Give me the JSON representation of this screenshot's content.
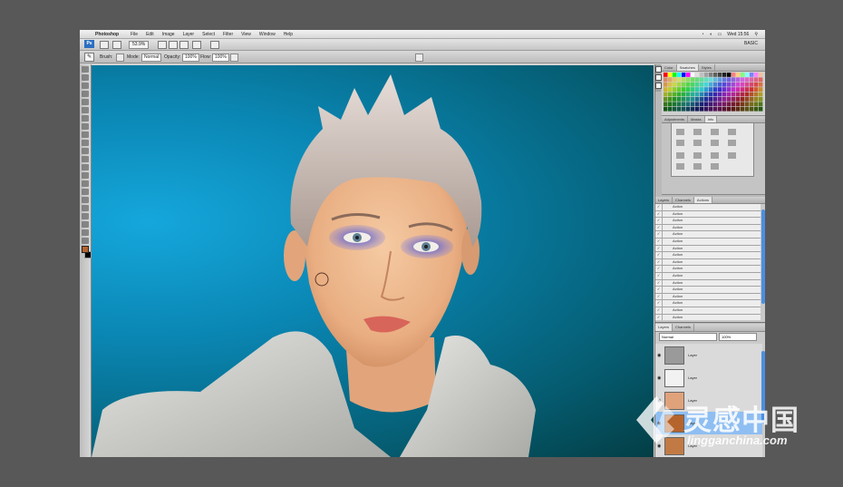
{
  "menubar": {
    "apple": "",
    "app_name": "Photoshop",
    "menus": [
      "File",
      "Edit",
      "Image",
      "Layer",
      "Select",
      "Filter",
      "View",
      "Window",
      "Help"
    ],
    "clock": "Wed 15:56"
  },
  "appbar": {
    "badge": "Ps",
    "zoom": "53.9%",
    "workspace": "BASIC"
  },
  "options": {
    "brush_label": "Brush:",
    "mode_label": "Mode:",
    "mode_value": "Normal",
    "opacity_label": "Opacity:",
    "opacity_value": "100%",
    "flow_label": "Flow:",
    "flow_value": "100%"
  },
  "swatches_panel": {
    "tabs": [
      "Color",
      "Swatches",
      "Styles"
    ],
    "active_tab": "Swatches"
  },
  "adjustments_panel": {
    "tabs": [
      "Adjustments",
      "Masks",
      "Info"
    ],
    "active_tab": "Info"
  },
  "actions_panel": {
    "tabs": [
      "Layers",
      "Channels",
      "Actions"
    ],
    "active_tab": "Actions",
    "items": [
      "Action",
      "Action",
      "Action",
      "Action",
      "Action",
      "Action",
      "Action",
      "Action",
      "Action",
      "Action",
      "Action",
      "Action",
      "Action",
      "Action",
      "Action",
      "Action",
      "Action",
      "Action",
      "Action"
    ],
    "selected_item": "Action"
  },
  "layers_panel": {
    "tabs": [
      "Layers",
      "Channels"
    ],
    "blend_mode": "Normal",
    "opacity": "100%",
    "layers": [
      {
        "name": "Layer",
        "selected": false
      },
      {
        "name": "Layer",
        "selected": false
      },
      {
        "name": "Layer",
        "selected": false
      },
      {
        "name": "Layer",
        "selected": true
      },
      {
        "name": "Layer",
        "selected": false
      }
    ]
  },
  "watermark": {
    "chinese": "灵感中国",
    "url": "lingganchina.com"
  },
  "colors": {
    "canvas_bright": "#15a7dc",
    "canvas_dark": "#033e45",
    "eyeshadow": "#3d47c9",
    "lips": "#d8655a",
    "selection_blue": "#8fbef2",
    "foreground_swatch": "#b5642d"
  }
}
